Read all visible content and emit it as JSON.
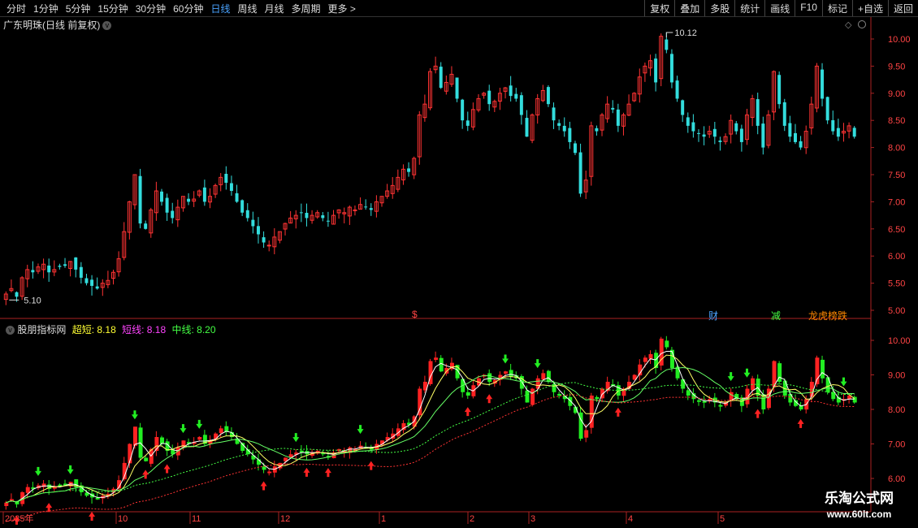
{
  "toolbar": {
    "periods": [
      "分时",
      "1分钟",
      "5分钟",
      "15分钟",
      "30分钟",
      "60分钟",
      "日线",
      "周线",
      "月线",
      "多周期",
      "更多 >"
    ],
    "active_period": "日线",
    "actions": [
      "复权",
      "叠加",
      "多股",
      "统计",
      "画线",
      "F10",
      "标记",
      "+自选",
      "返回"
    ]
  },
  "stock": {
    "title": "广东明珠(日线 前复权)",
    "high_label": "10.12",
    "low_label": "5.10",
    "price_axis": [
      "10.00",
      "9.50",
      "9.00",
      "8.50",
      "8.00",
      "7.50",
      "7.00",
      "6.50",
      "6.00",
      "5.50",
      "5.00"
    ],
    "markers": [
      {
        "text": "$",
        "color": "#ff4444"
      },
      {
        "text": "财",
        "color": "#4aa3ff"
      },
      {
        "text": "减",
        "color": "#44ff44"
      },
      {
        "text": "龙虎榜跌",
        "color": "#ff8800"
      }
    ]
  },
  "indicator": {
    "name": "股朋指标网",
    "chaoduan_label": "超短:",
    "chaoduan_value": "8.18",
    "duanxian_label": "短线:",
    "duanxian_value": "8.18",
    "zhongxian_label": "中线:",
    "zhongxian_value": "8.20",
    "axis": [
      "10.00",
      "9.00",
      "8.00",
      "7.00",
      "6.00"
    ]
  },
  "dates": [
    "2025年",
    "10",
    "11",
    "12",
    "1",
    "2",
    "3",
    "4",
    "5"
  ],
  "watermark": {
    "line1": "乐淘公式网",
    "line2": "www.60lt.com"
  },
  "colors": {
    "up": "#ff3333",
    "down": "#33dddd",
    "accent": "#4aa3ff",
    "axis": "#ff4444"
  },
  "chart_data": {
    "type": "candlestick",
    "title": "广东明珠(日线 前复权)",
    "ylim": [
      4.9,
      10.3
    ],
    "annotations": [
      {
        "label": "10.12",
        "value": 10.12
      },
      {
        "label": "5.10",
        "value": 5.1
      }
    ],
    "closes": [
      5.3,
      5.4,
      5.25,
      5.6,
      5.75,
      5.7,
      5.8,
      5.85,
      5.7,
      5.75,
      5.8,
      5.82,
      5.9,
      5.75,
      5.6,
      5.5,
      5.45,
      5.4,
      5.5,
      5.55,
      5.7,
      5.95,
      6.45,
      7.0,
      7.5,
      6.6,
      6.5,
      6.85,
      7.2,
      7.0,
      6.8,
      6.7,
      6.9,
      7.1,
      7.0,
      7.05,
      7.2,
      7.0,
      7.1,
      7.3,
      7.45,
      7.35,
      7.2,
      7.0,
      6.8,
      6.7,
      6.55,
      6.4,
      6.25,
      6.2,
      6.35,
      6.45,
      6.6,
      6.7,
      6.75,
      6.8,
      6.7,
      6.75,
      6.8,
      6.7,
      6.65,
      6.75,
      6.85,
      6.8,
      6.9,
      6.85,
      6.95,
      6.9,
      6.85,
      7.0,
      7.1,
      7.2,
      7.3,
      7.45,
      7.6,
      7.55,
      7.8,
      8.6,
      8.8,
      9.4,
      9.5,
      9.1,
      9.2,
      9.35,
      8.9,
      8.5,
      8.4,
      8.7,
      8.9,
      9.0,
      8.8,
      8.85,
      9.0,
      9.1,
      8.95,
      8.9,
      8.6,
      8.2,
      8.6,
      8.9,
      9.05,
      8.8,
      8.5,
      8.4,
      8.3,
      8.1,
      7.9,
      7.15,
      7.4,
      8.4,
      8.3,
      8.6,
      8.8,
      8.7,
      8.4,
      8.6,
      8.8,
      9.0,
      9.3,
      9.5,
      9.6,
      9.2,
      10.05,
      9.8,
      9.2,
      8.9,
      8.6,
      8.4,
      8.3,
      8.25,
      8.2,
      8.3,
      8.2,
      8.1,
      8.2,
      8.5,
      8.3,
      8.1,
      8.6,
      8.9,
      8.4,
      8.0,
      8.6,
      9.4,
      8.8,
      8.4,
      8.2,
      8.1,
      8.0,
      8.3,
      8.8,
      9.5,
      8.9,
      8.5,
      8.3,
      8.2,
      8.3,
      8.4,
      8.2
    ]
  }
}
